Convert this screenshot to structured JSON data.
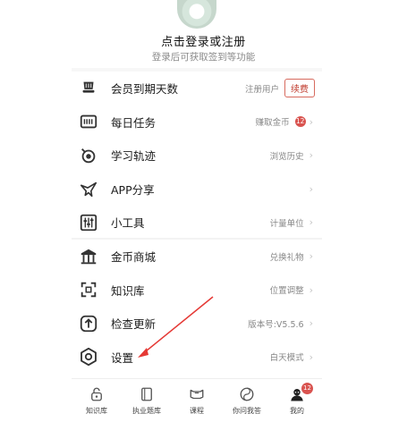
{
  "header": {
    "login_title": "点击登录或注册",
    "login_subtitle": "登录后可获取签到等功能"
  },
  "menu_group_1": [
    {
      "icon": "hat-icon",
      "label": "会员到期天数",
      "right": "注册用户",
      "button": "续费"
    },
    {
      "icon": "task-icon",
      "label": "每日任务",
      "right": "赚取金币",
      "badge": "12"
    },
    {
      "icon": "track-icon",
      "label": "学习轨迹",
      "right": "浏览历史"
    },
    {
      "icon": "share-bird-icon",
      "label": "APP分享",
      "right": ""
    },
    {
      "icon": "tools-icon",
      "label": "小工具",
      "right": "计量单位"
    }
  ],
  "menu_group_2": [
    {
      "icon": "shop-icon",
      "label": "金币商城",
      "right": "兑换礼物"
    },
    {
      "icon": "knowledge-icon",
      "label": "知识库",
      "right": "位置调整"
    },
    {
      "icon": "update-icon",
      "label": "检查更新",
      "right": "版本号:V5.5.6"
    },
    {
      "icon": "settings-icon",
      "label": "设置",
      "right": "白天模式"
    }
  ],
  "bottom_nav": [
    {
      "icon": "knowledge-tab-icon",
      "label": "知识库"
    },
    {
      "icon": "question-bank-icon",
      "label": "执业题库"
    },
    {
      "icon": "course-icon",
      "label": "课程"
    },
    {
      "icon": "ask-icon",
      "label": "你问我答"
    },
    {
      "icon": "profile-icon",
      "label": "我的",
      "badge": "12"
    }
  ],
  "colors": {
    "accent_red": "#d9534f",
    "annotation_arrow": "#e53935"
  }
}
